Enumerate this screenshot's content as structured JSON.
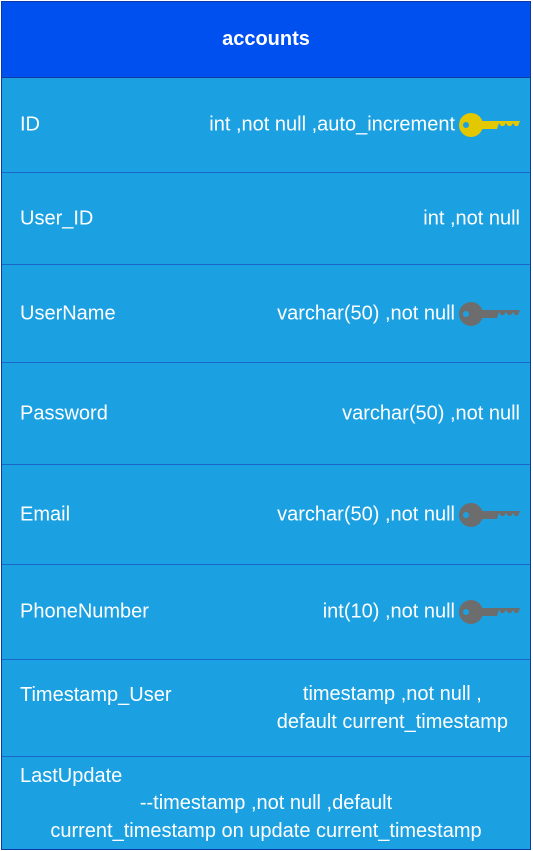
{
  "table": {
    "title": "accounts",
    "colors": {
      "header_bg": "#0050ef",
      "body_bg": "#1ba1e2",
      "primary_key": "#e3c800",
      "secondary_key": "#6d6d6d"
    },
    "rows": [
      {
        "name": "ID",
        "type": "int ,not null ,auto_increment",
        "key_icon": "primary-key-icon"
      },
      {
        "name": "User_ID",
        "type": "int ,not null",
        "key_icon": ""
      },
      {
        "name": "UserName",
        "type": "varchar(50) ,not null",
        "key_icon": "key-icon"
      },
      {
        "name": "Password",
        "type": "varchar(50) ,not null",
        "key_icon": ""
      },
      {
        "name": "Email",
        "type": "varchar(50) ,not null",
        "key_icon": "key-icon"
      },
      {
        "name": "PhoneNumber",
        "type": "int(10) ,not null",
        "key_icon": "key-icon"
      },
      {
        "name": "Timestamp_User",
        "type_line1": "timestamp ,not null ,",
        "type_line2": "default current_timestamp",
        "key_icon": ""
      },
      {
        "name": "LastUpdate",
        "type_line1": "--timestamp ,not null ,default",
        "type_line2": "current_timestamp on update current_timestamp",
        "key_icon": ""
      }
    ]
  }
}
